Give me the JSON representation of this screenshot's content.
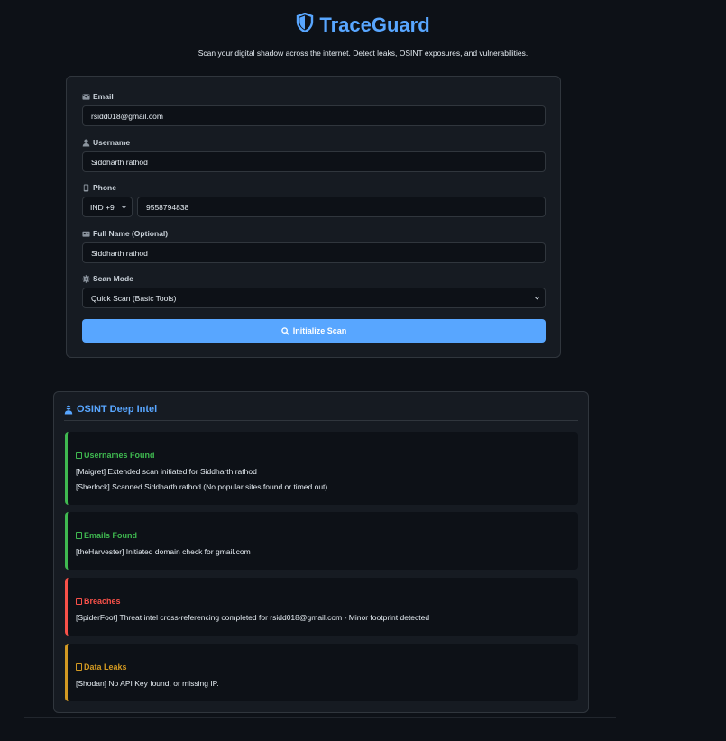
{
  "header": {
    "title": "TraceGuard",
    "tagline": "Scan your digital shadow across the internet. Detect leaks, OSINT exposures, and vulnerabilities."
  },
  "form": {
    "email_label": "Email",
    "email_value": "rsidd018@gmail.com",
    "username_label": "Username",
    "username_value": "Siddharth rathod",
    "phone_label": "Phone",
    "country_code": "IND +9",
    "phone_value": "9558794838",
    "fullname_label": "Full Name (Optional)",
    "fullname_value": "Siddharth rathod",
    "scanmode_label": "Scan Mode",
    "scanmode_value": "Quick Scan (Basic Tools)",
    "scan_button": "Initialize Scan"
  },
  "intel": {
    "title": "OSINT Deep Intel",
    "sections": [
      {
        "title": "Usernames Found",
        "status_color": "#3fb950",
        "lines": [
          "[Maigret] Extended scan initiated for Siddharth rathod",
          "[Sherlock] Scanned Siddharth rathod (No popular sites found or timed out)"
        ]
      },
      {
        "title": "Emails Found",
        "status_color": "#3fb950",
        "lines": [
          "[theHarvester] Initiated domain check for gmail.com"
        ]
      },
      {
        "title": "Breaches",
        "status_color": "#f85149",
        "lines": [
          "[SpiderFoot] Threat intel cross-referencing completed for rsidd018@gmail.com - Minor footprint detected"
        ]
      },
      {
        "title": "Data Leaks",
        "status_color": "#d29922",
        "lines": [
          "[Shodan] No API Key found, or missing IP."
        ]
      }
    ]
  },
  "colors": {
    "accent": "#58a6ff",
    "background": "#0d1117",
    "card": "#161b22"
  },
  "icons": [
    "shield-icon",
    "envelope-icon",
    "user-icon",
    "phone-icon",
    "id-card-icon",
    "gear-icon",
    "chevron-down-icon",
    "search-icon",
    "user-secret-icon",
    "section-status-icon"
  ]
}
